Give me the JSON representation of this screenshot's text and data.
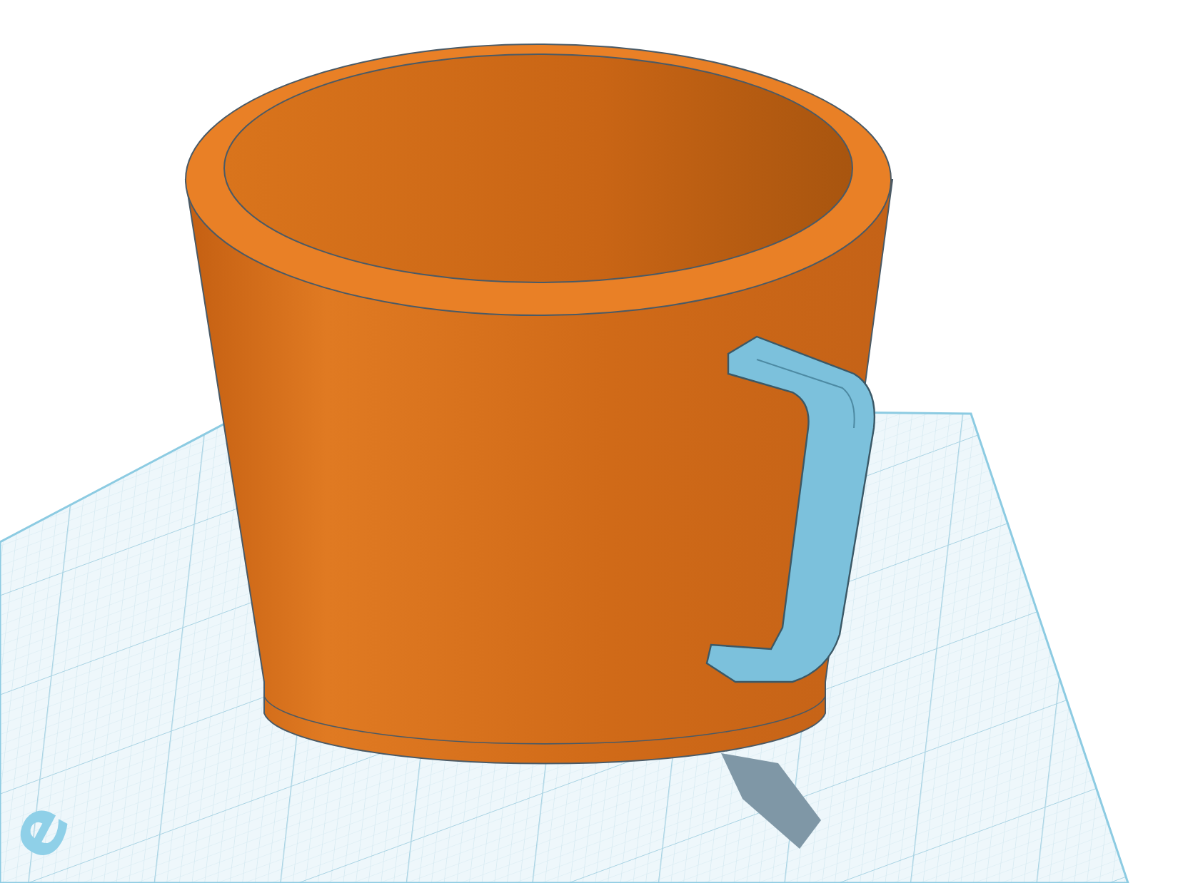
{
  "scene": {
    "workplane_label": "e"
  }
}
